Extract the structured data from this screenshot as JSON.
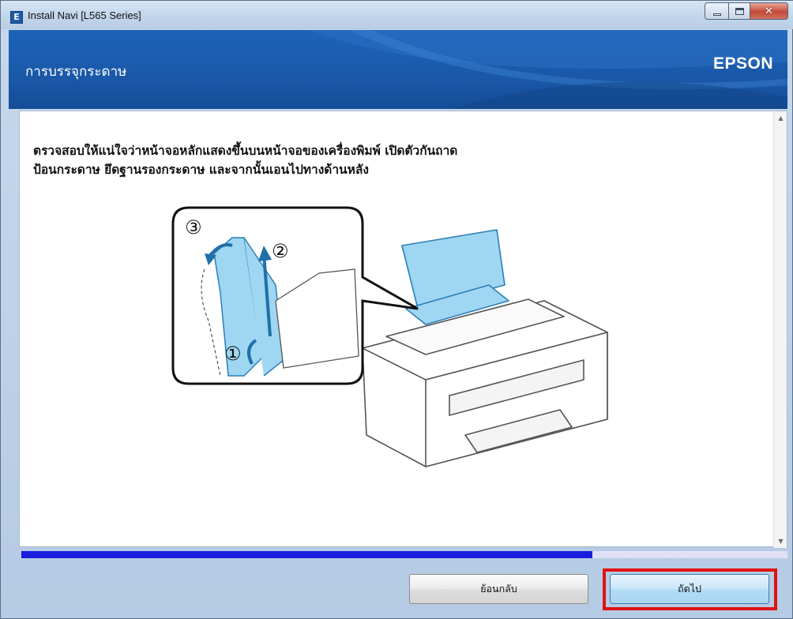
{
  "window": {
    "title": "Install Navi [L565 Series]",
    "app_icon_letter": "E"
  },
  "header": {
    "title": "การบรรจุกระดาษ",
    "brand": "EPSON"
  },
  "content": {
    "instruction_line1": "ตรวจสอบให้แน่ใจว่าหน้าจอหลักแสดงขึ้นบนหน้าจอของเครื่องพิมพ์ เปิดตัวกันถาด",
    "instruction_line2": "ป้อนกระดาษ ยึดฐานรองกระดาษ และจากนั้นเอนไปทางด้านหลัง",
    "step_labels": [
      "①",
      "②",
      "③"
    ]
  },
  "progress": {
    "value": 0.745,
    "fill_color": "#1a1ddd",
    "track_color": "#dfe0f6"
  },
  "buttons": {
    "back_label": "ย้อนกลับ",
    "next_label": "ถัดไป"
  },
  "colors": {
    "header_blue": "#1a58a8",
    "highlight_red": "#e01212"
  },
  "icons": {
    "scroll_up": "▲",
    "scroll_down": "▼",
    "close": "✕"
  }
}
